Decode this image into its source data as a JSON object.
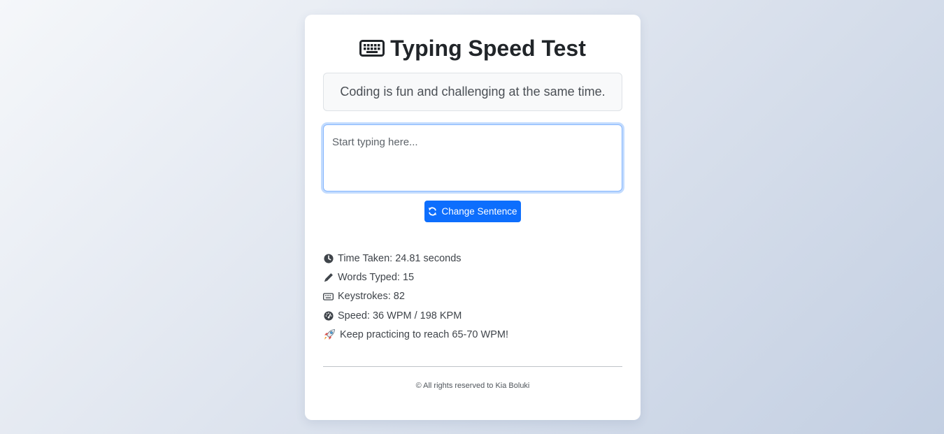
{
  "header": {
    "title": "Typing Speed Test",
    "icon": "keyboard-icon"
  },
  "sentence": {
    "text": "Coding is fun and challenging at the same time."
  },
  "input": {
    "value": "",
    "placeholder": "Start typing here..."
  },
  "actions": {
    "change_sentence_label": "Change Sentence",
    "change_sentence_icon": "refresh-icon"
  },
  "stats": {
    "time_taken": "Time Taken: 24.81 seconds",
    "words_typed": "Words Typed: 15",
    "keystrokes": "Keystrokes: 82",
    "speed": "Speed: 36 WPM / 198 KPM",
    "message": "Keep practicing to reach 65-70 WPM!"
  },
  "footer": {
    "text": "© All rights reserved to Kia Boluki"
  },
  "colors": {
    "accent": "#0d6efd",
    "card_background": "#ffffff",
    "sentence_background": "#f8f9fa"
  }
}
